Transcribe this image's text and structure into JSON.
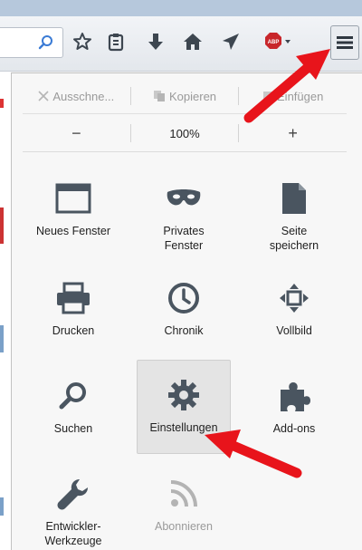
{
  "toolbar": {
    "icons": [
      "search-icon",
      "star-icon",
      "clipboard-icon",
      "download-icon",
      "home-icon",
      "send-icon",
      "adblock-icon",
      "menu-icon"
    ],
    "adblock_badge": "ABP"
  },
  "menu": {
    "edit": {
      "cut_label": "Ausschne...",
      "copy_label": "Kopieren",
      "paste_label": "Einfügen"
    },
    "zoom": {
      "minus": "−",
      "level": "100%",
      "plus": "+"
    },
    "items": [
      {
        "label": "Neues Fenster",
        "icon": "window-icon"
      },
      {
        "label": "Privates\nFenster",
        "icon": "mask-icon"
      },
      {
        "label": "Seite\nspeichern",
        "icon": "page-icon"
      },
      {
        "label": "Drucken",
        "icon": "printer-icon"
      },
      {
        "label": "Chronik",
        "icon": "clock-icon"
      },
      {
        "label": "Vollbild",
        "icon": "fullscreen-icon"
      },
      {
        "label": "Suchen",
        "icon": "search-icon"
      },
      {
        "label": "Einstellungen",
        "icon": "gear-icon"
      },
      {
        "label": "Add-ons",
        "icon": "puzzle-icon"
      },
      {
        "label": "Entwickler-\nWerkzeuge",
        "icon": "wrench-icon"
      },
      {
        "label": "Abonnieren",
        "icon": "rss-icon"
      }
    ]
  },
  "colors": {
    "arrow": "#e8141b",
    "icon": "#4a5560",
    "disabled": "#a8a8a8"
  }
}
